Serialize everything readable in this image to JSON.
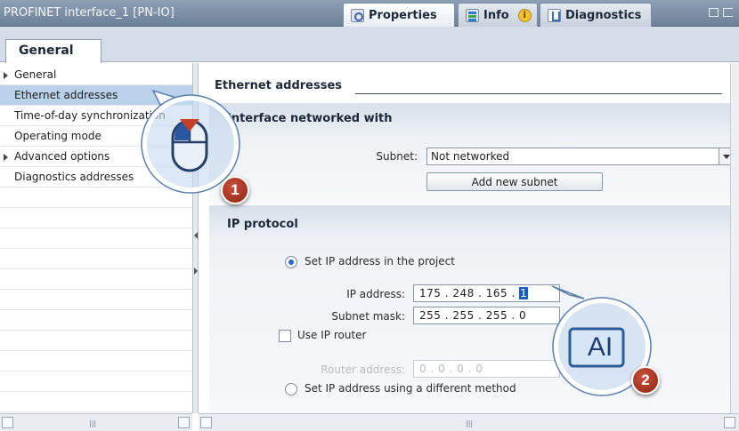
{
  "window": {
    "title": "PROFINET interface_1 [PN-IO]",
    "tabs": [
      {
        "label": "Properties",
        "icon": "properties-icon"
      },
      {
        "label": "Info",
        "icon": "info-icon"
      },
      {
        "label": "Diagnostics",
        "icon": "diagnostics-icon"
      }
    ],
    "info_badge": "i"
  },
  "inspector": {
    "tab_label": "General"
  },
  "tree": {
    "items": [
      {
        "label": "General",
        "expandable": true
      },
      {
        "label": "Ethernet addresses",
        "selected": true
      },
      {
        "label": "Time-of-day synchronization"
      },
      {
        "label": "Operating mode"
      },
      {
        "label": "Advanced options",
        "expandable": true
      },
      {
        "label": "Diagnostics addresses"
      }
    ]
  },
  "main": {
    "section_title": "Ethernet addresses",
    "networked": {
      "title": "Interface networked with",
      "subnet_label": "Subnet:",
      "subnet_value": "Not networked",
      "add_subnet_label": "Add new subnet"
    },
    "ip": {
      "title": "IP protocol",
      "option_project": "Set IP address in the project",
      "ip_label": "IP address:",
      "ip_octets": [
        "175",
        "248",
        "165"
      ],
      "ip_last": "1",
      "mask_label": "Subnet mask:",
      "mask_value": "255 . 255 . 255 . 0",
      "router_check_label": "Use IP router",
      "router_label": "Router address:",
      "router_value": "0 . 0 . 0 . 0",
      "option_other": "Set IP address using a different method"
    }
  },
  "callouts": [
    {
      "number": "1"
    },
    {
      "number": "2"
    }
  ],
  "cursor_text": "AI",
  "colors": {
    "selection": "#b9d2ea",
    "title_bar": "#7d8ea6",
    "badge": "#a8321f",
    "text_cursor_box": "#2f6fc0"
  }
}
